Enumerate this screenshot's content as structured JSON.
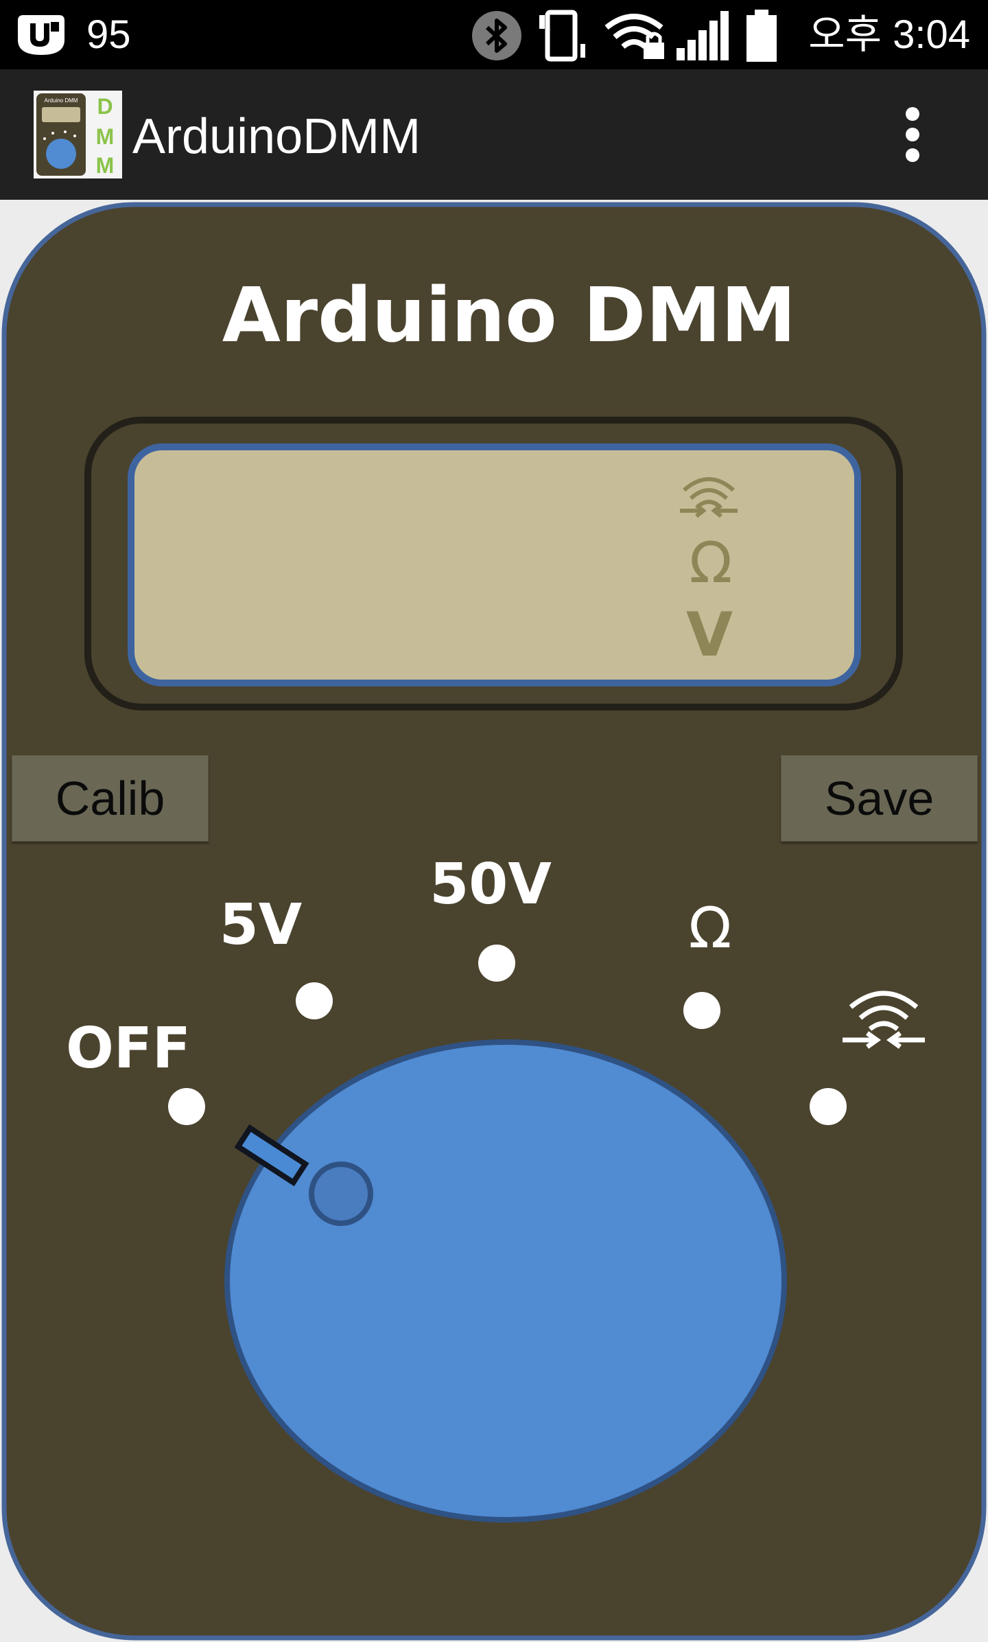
{
  "status_bar": {
    "battery_percent": "95",
    "clock": "오후 3:04",
    "icons": [
      "u-plus-icon",
      "bluetooth-icon",
      "vibrate-icon",
      "wifi-lock-icon",
      "signal-icon",
      "battery-icon"
    ]
  },
  "app_bar": {
    "title": "ArduinoDMM",
    "logo_letters": [
      "D",
      "M",
      "M"
    ],
    "logo_mini_title": "Arduino DMM",
    "menu_icon": "overflow-menu-icon"
  },
  "meter": {
    "title": "Arduino DMM",
    "display": {
      "indicator_continuity_icon": "continuity-icon",
      "indicator_ohm": "Ω",
      "indicator_volt": "V"
    },
    "buttons": {
      "calib": "Calib",
      "save": "Save"
    },
    "dial": {
      "positions": [
        "OFF",
        "5V",
        "50V",
        "Ω"
      ],
      "continuity_icon": "continuity-icon",
      "selected": "OFF"
    }
  },
  "colors": {
    "body": "#4a432e",
    "body_border": "#46669a",
    "lcd": "#c6bd98",
    "lcd_border": "#3e64a0",
    "knob": "#518bd2",
    "indicator": "#8f8658",
    "button": "#6a6855"
  }
}
